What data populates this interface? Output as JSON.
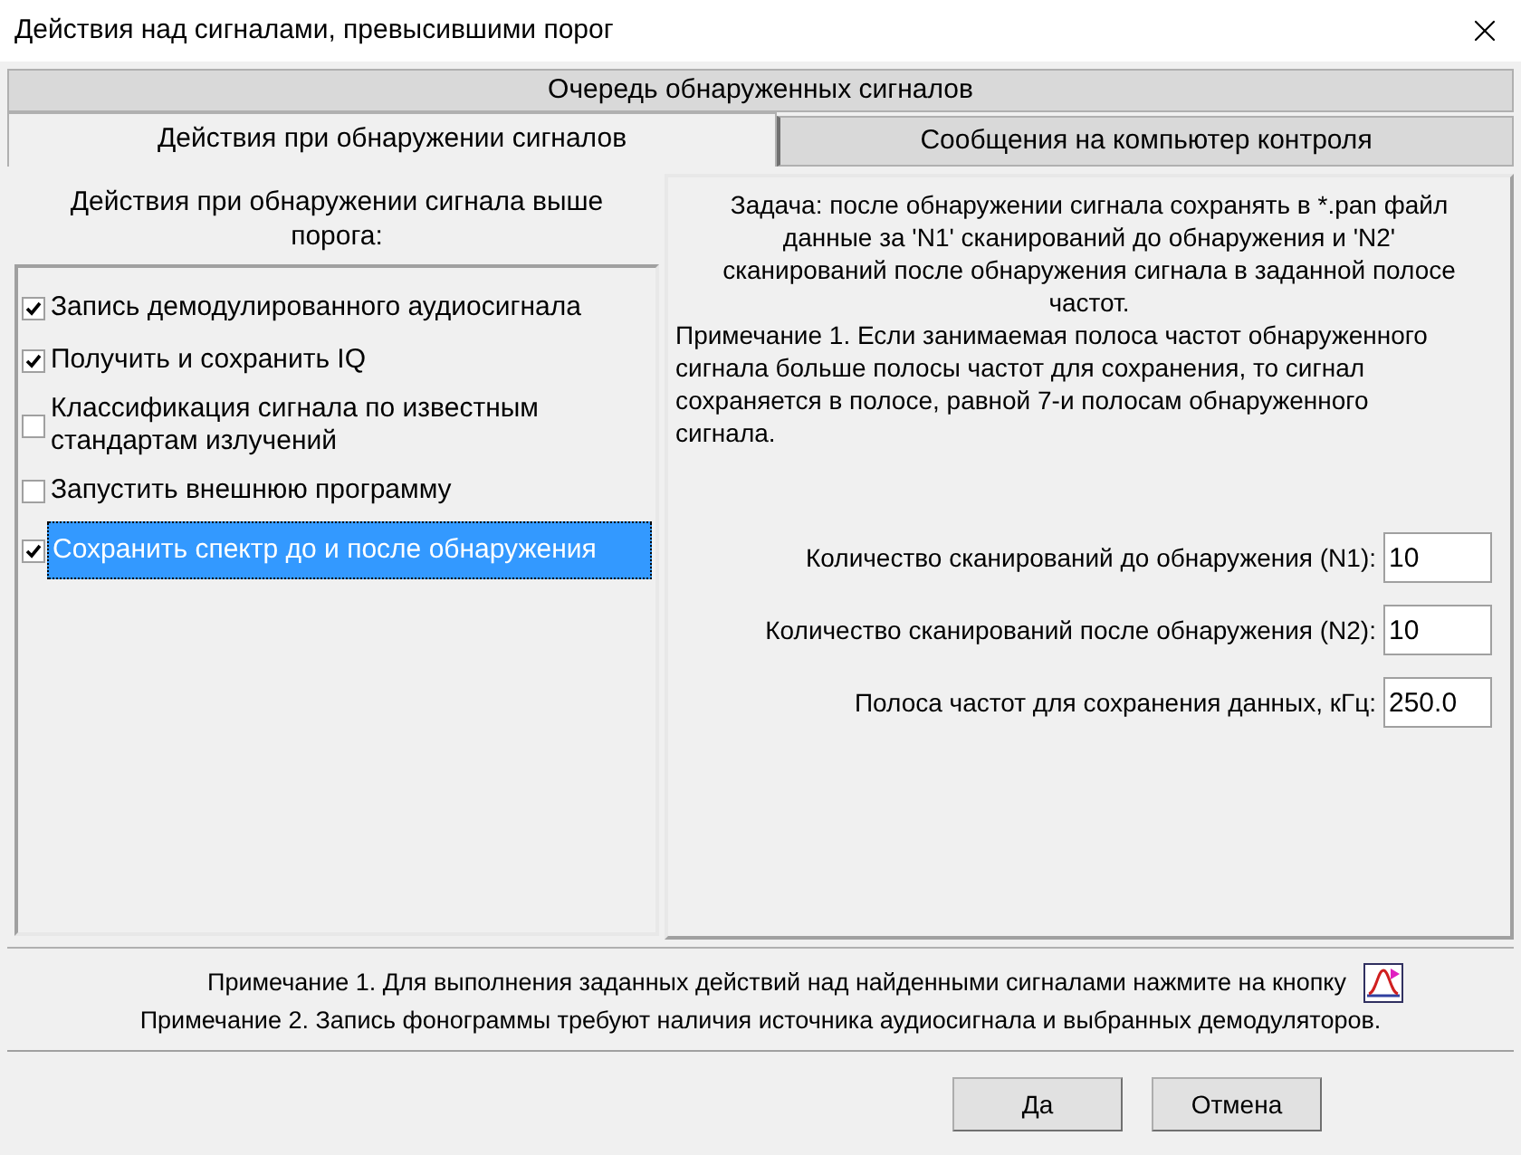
{
  "window": {
    "title": "Действия над сигналами, превысившими порог"
  },
  "tab_rows": [
    [
      {
        "label": "Очередь обнаруженных сигналов",
        "selected": false
      }
    ],
    [
      {
        "label": "Действия при обнаружении сигналов",
        "selected": true
      },
      {
        "label": "Сообщения на компьютер контроля",
        "selected": false
      }
    ]
  ],
  "actions": {
    "heading": "Действия при обнаружении сигнала выше порога:",
    "items": [
      {
        "label": "Запись демодулированного аудиосигнала",
        "checked": true,
        "selected": false
      },
      {
        "label": "Получить и сохранить IQ",
        "checked": true,
        "selected": false
      },
      {
        "label": "Классификация сигнала по известным стандартам излучений",
        "checked": false,
        "selected": false
      },
      {
        "label": "Запустить внешнюю программу",
        "checked": false,
        "selected": false
      },
      {
        "label": "Сохранить спектр до и после обнаружения",
        "checked": true,
        "selected": true
      }
    ]
  },
  "details": {
    "task": "Задача: после обнаружении сигнала сохранять в *.pan файл данные за 'N1' сканирований до обнаружения и 'N2' сканирований после обнаружения сигнала в заданной полосе частот.",
    "note": "Примечание 1. Если занимаемая полоса частот обнаруженного сигнала больше полосы частот для сохранения, то сигнал сохраняется в полосе, равной 7-и полосам обнаруженного сигнала.",
    "fields": [
      {
        "label": "Количество сканирований до обнаружения (N1):",
        "value": "10"
      },
      {
        "label": "Количество сканирований после обнаружения (N2):",
        "value": "10"
      },
      {
        "label": "Полоса частот для сохранения данных, кГц:",
        "value": "250.0"
      }
    ]
  },
  "notes": [
    "Примечание 1. Для выполнения заданных действий  над найденными сигналами нажмите на кнопку",
    "Примечание 2. Запись фонограммы требуют наличия источника аудиосигнала и выбранных демодуляторов."
  ],
  "buttons": [
    "Да",
    "Отмена"
  ]
}
